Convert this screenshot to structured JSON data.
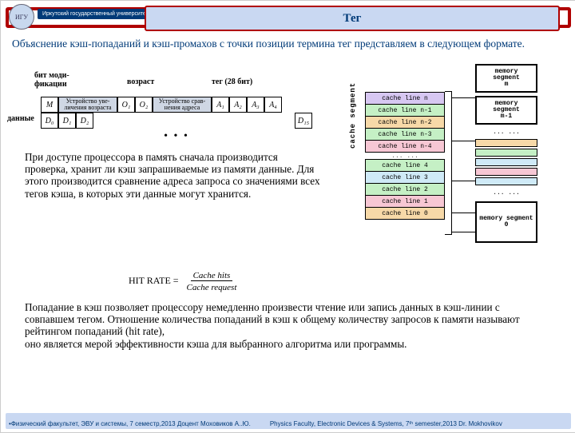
{
  "header": {
    "university_name": "Иркутский государственный университет",
    "logo_letters": "ИГУ",
    "title": "Тег"
  },
  "intro": "Объяснение кэш-попаданий и кэш-промахов с точки позиции термина тег представляем в следующем формате.",
  "diagram1": {
    "label_modbit": "бит моди-\nфикации",
    "label_age": "возраст",
    "label_tag": "тег (28 бит)",
    "label_data": "данные",
    "h_age_inc": "Устройство уве-личения возраста",
    "h_addr_cmp": "Устройство срав-нения адреса",
    "M": "M",
    "O1": "O₁",
    "O2": "O₂",
    "A1": "A₁",
    "A2": "A₂",
    "A3": "A₃",
    "A4": "A₄",
    "D0": "D₀",
    "D1": "D₁",
    "D2": "D₂",
    "D15": "D₁₅",
    "ellipsis": "• • •"
  },
  "mid_text": "При доступе процессора в память сначала производится проверка, хранит ли кэш запрашиваемые из памяти данные. Для этого производится сравнение адреса запроса со значениями всех тегов кэша, в которых эти данные могут хранится.",
  "formula": {
    "lhs": "HIT RATE =",
    "num": "Cache hits",
    "den": "Cache request"
  },
  "diagram2": {
    "vlabel": "cache segment",
    "cache_lines_top": [
      "cache line n",
      "cache line n-1",
      "cache line n-2",
      "cache line n-3",
      "cache line n-4"
    ],
    "gap": "... ...",
    "cache_lines_bot": [
      "cache line 4",
      "cache line 3",
      "cache line 2",
      "cache line 1",
      "cache line 0"
    ],
    "colors_top": [
      "#d7c7f2",
      "#c5f0c5",
      "#f7d9a8",
      "#c5f0c5",
      "#f7c7d4"
    ],
    "colors_bot": [
      "#c5f0c5",
      "#cfeaf7",
      "#c5f0c5",
      "#f7c7d4",
      "#f7d9a8"
    ],
    "mem": {
      "m": "memory\nsegment\nm",
      "m1": "memory\nsegment\nm-1",
      "gap": "... ...",
      "s0": "memory\nsegment\n0"
    },
    "strip_colors": [
      "#f7d9a8",
      "#c5f0c5",
      "#cfeaf7",
      "#f7c7d4",
      "#cfeaf7"
    ]
  },
  "bottom_text": "Попадание в кэш позволяет процессору немедленно произвести чтение или запись данных в кэш-линии с совпавшем тегом. Отношение количества попаданий в кэш к общему количеству запросов к памяти называют рейтингом попаданий (hit rate),\n оно является мерой эффективности кэша для выбранного алгоритма или программы.",
  "footer": {
    "left": "Физический факультет, ЭВУ и системы, 7 семестр,2013 Доцент Моховиков А..Ю.",
    "right": "Physics Faculty, Electronic Devices & Systems, 7ᵗʰ semester,2013  Dr. Mokhovikov"
  }
}
